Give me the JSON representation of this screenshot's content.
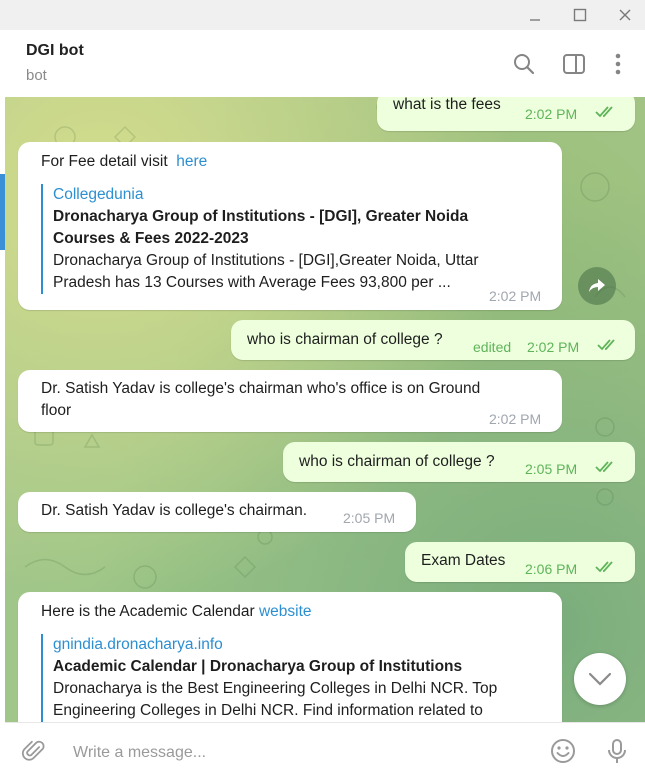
{
  "window": {
    "minimize_icon": "minimize-icon",
    "maximize_icon": "maximize-icon",
    "close_icon": "close-icon"
  },
  "header": {
    "title": "DGI bot",
    "status": "bot",
    "icons": [
      "search-icon",
      "sidebar-toggle-icon",
      "more-vertical-icon"
    ]
  },
  "messages": [
    {
      "direction": "out",
      "text": "what is the fees",
      "time": "2:02 PM",
      "read": true
    },
    {
      "direction": "in",
      "text": "For Fee detail visit",
      "link_text": "here",
      "preview": {
        "site": "Collegedunia",
        "title_line1": "Dronacharya Group of Institutions - [DGI], Greater Noida",
        "title_line2": "Courses & Fees 2022-2023",
        "desc_line1": "Dronacharya Group of Institutions - [DGI],Greater Noida, Uttar",
        "desc_line2": "Pradesh has 13 Courses with Average Fees 93,800 per ..."
      },
      "time": "2:02 PM"
    },
    {
      "direction": "out",
      "text": "who is chairman of college ?",
      "edited_label": "edited",
      "time": "2:02 PM",
      "read": true
    },
    {
      "direction": "in",
      "text_line1": "Dr. Satish Yadav is college's chairman who's office is on Ground",
      "text_line2": "floor",
      "time": "2:02 PM"
    },
    {
      "direction": "out",
      "text": "who is chairman of college ?",
      "time": "2:05 PM",
      "read": true
    },
    {
      "direction": "in",
      "text": "Dr. Satish Yadav is college's chairman.",
      "time": "2:05 PM"
    },
    {
      "direction": "out",
      "text": "Exam Dates",
      "time": "2:06 PM",
      "read": true
    },
    {
      "direction": "in",
      "text": "Here is the Academic Calendar",
      "link_text": "website",
      "preview": {
        "site": "gnindia.dronacharya.info",
        "title_line1": "Academic Calendar | Dronacharya Group of Institutions",
        "desc_line1": "Dronacharya is the Best Engineering Colleges in Delhi NCR. Top",
        "desc_line2": "Engineering Colleges in Delhi NCR. Find information related to"
      }
    }
  ],
  "composer": {
    "placeholder": "Write a message...",
    "icons": [
      "attach-icon",
      "emoji-icon",
      "microphone-icon"
    ]
  },
  "colors": {
    "accent": "#2c8fd1",
    "outgoing_bubble": "#eeffde",
    "read_ticks": "#5fb45a"
  }
}
